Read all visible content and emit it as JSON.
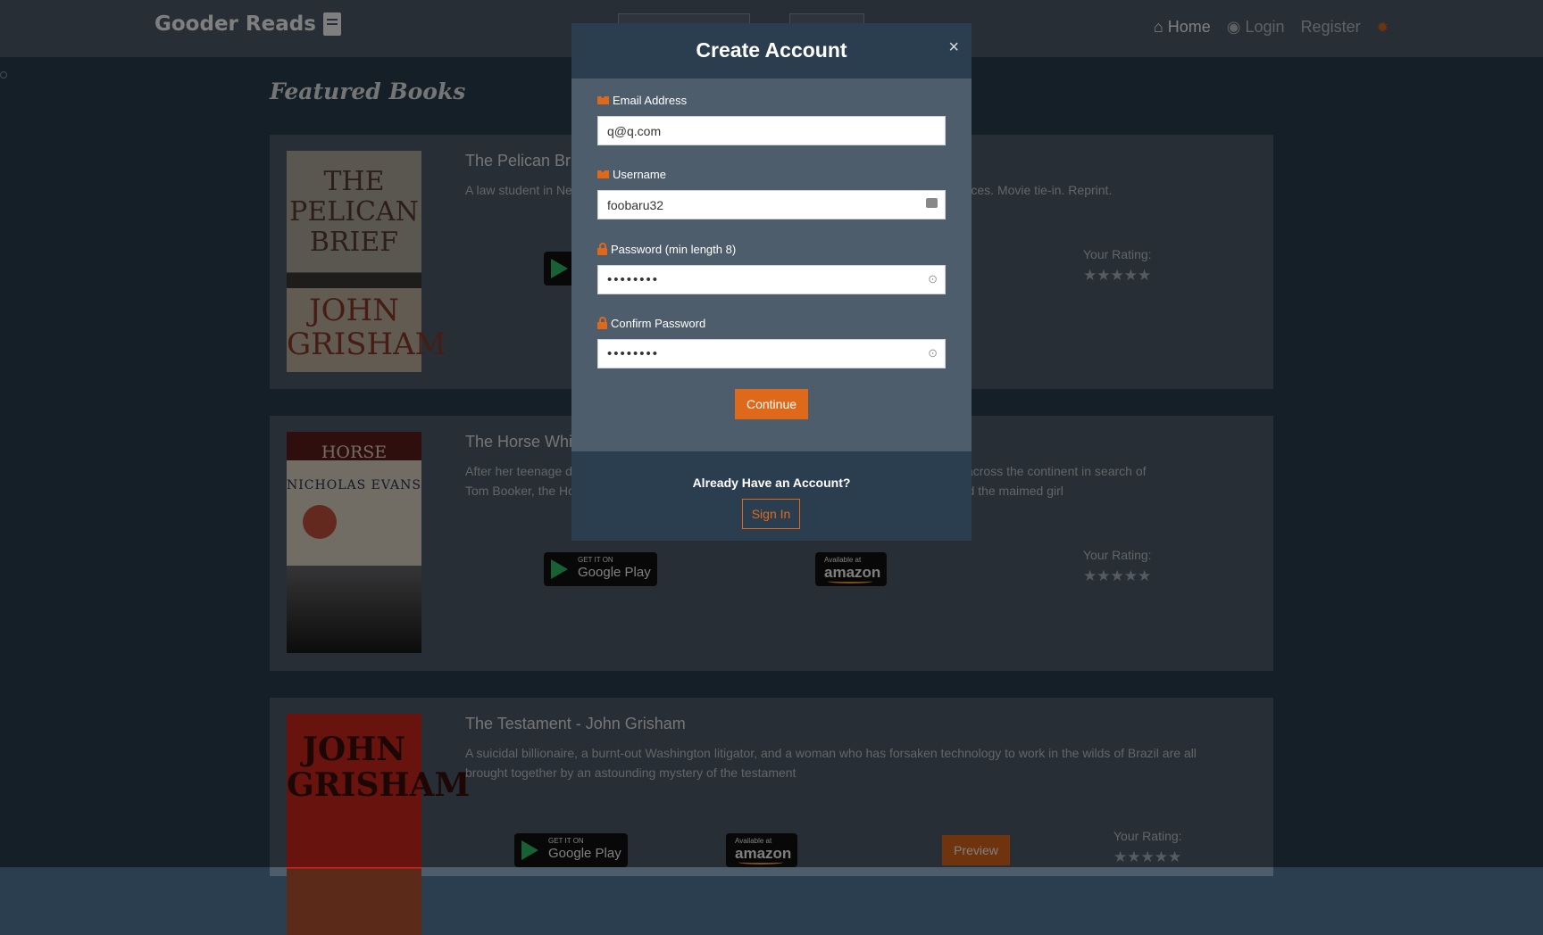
{
  "navbar": {
    "brand": "Gooder Reads",
    "links": [
      "Home",
      "Login",
      "Register"
    ]
  },
  "page": {
    "title": "Featured Books",
    "rating_label": "Your Rating:",
    "books": [
      {
        "title": "The Pelican Bri",
        "description": "A law student in Ne                                                                                                                laces. Movie tie-in. Reprint."
      },
      {
        "title": "The Horse Whi",
        "description_line1": "After her teenage d                                                                                                s journeys across the continent in search of",
        "description_line2": "Tom Booker, the Ho                                                                                              he horse and the maimed girl"
      },
      {
        "title": "The Testament - John Grisham",
        "description": "A suicidal billionaire, a burnt-out Washington litigator, and a woman who has forsaken technology to work in the wilds of Brazil are all brought together by an astounding mystery of the testament",
        "preview_label": "Preview"
      }
    ],
    "stores": {
      "gplay_small": "GET IT ON",
      "gplay_big": "Google Play",
      "amazon_small": "Available at",
      "amazon_big": "amazon"
    }
  },
  "modal": {
    "title": "Create Account",
    "close": "×",
    "email_label": "Email Address",
    "email_value": "q@q.com",
    "username_label": "Username",
    "username_value": "foobaru32",
    "password_label": "Password (min length 8)",
    "password_value": "••••••••",
    "confirm_label": "Confirm Password",
    "confirm_value": "••••••••",
    "continue_label": "Continue",
    "footer_text": "Already Have an Account?",
    "signin_label": "Sign In"
  },
  "colors": {
    "accent": "#df691a",
    "background": "#2b3e50",
    "panel": "#4e5d6c"
  }
}
